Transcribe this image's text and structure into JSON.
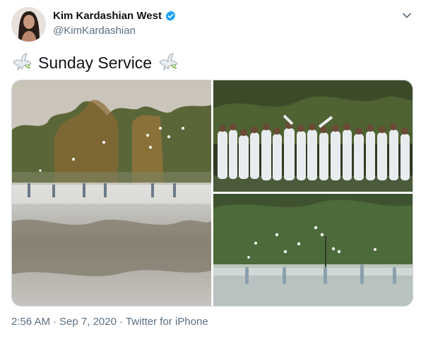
{
  "author": {
    "display_name": "Kim Kardashian West",
    "handle": "@KimKardashian",
    "verified": true
  },
  "tweet": {
    "text": "Sunday Service",
    "emoji_left": "dove-icon",
    "emoji_right": "dove-icon"
  },
  "media": {
    "photos": [
      {
        "description_name": "photo-fog-lake-birds"
      },
      {
        "description_name": "photo-group-white-clothing"
      },
      {
        "description_name": "photo-people-lake-doves"
      }
    ]
  },
  "meta": {
    "time": "2:56 AM",
    "separator": "·",
    "date": "Sep 7, 2020",
    "source": "Twitter for iPhone"
  },
  "colors": {
    "text_primary": "#0f1419",
    "text_secondary": "#5b7083",
    "verified_blue": "#1da1f2",
    "border": "#cfd9de"
  }
}
